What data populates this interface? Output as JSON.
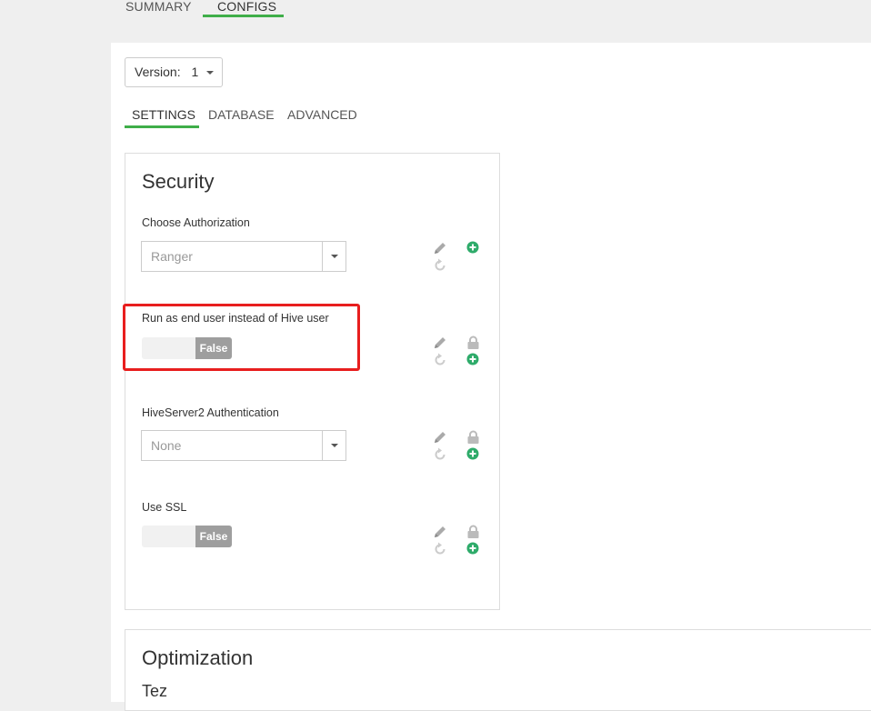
{
  "top_tabs": [
    {
      "label": "SUMMARY",
      "active": false
    },
    {
      "label": "CONFIGS",
      "active": true
    }
  ],
  "version": {
    "label": "Version:",
    "value": "1"
  },
  "sub_tabs": [
    {
      "label": "SETTINGS",
      "active": true
    },
    {
      "label": "DATABASE",
      "active": false
    },
    {
      "label": "ADVANCED",
      "active": false
    }
  ],
  "security": {
    "title": "Security",
    "fields": [
      {
        "label": "Choose Authorization",
        "type": "combo",
        "value": "Ranger"
      },
      {
        "label": "Run as end user instead of Hive user",
        "type": "toggle",
        "value": "False"
      },
      {
        "label": "HiveServer2 Authentication",
        "type": "combo",
        "value": "None"
      },
      {
        "label": "Use SSL",
        "type": "toggle",
        "value": "False"
      }
    ]
  },
  "optimization": {
    "title": "Optimization",
    "subtitle": "Tez"
  },
  "icons": {
    "edit": "pencil-icon",
    "undo": "undo-icon",
    "lock": "lock-icon",
    "add": "plus-circle-icon"
  },
  "colors": {
    "accent": "#3fae49",
    "add_icon": "#2eab6a",
    "highlight": "#e81e1e",
    "toggle_off": "#9e9e9e"
  }
}
